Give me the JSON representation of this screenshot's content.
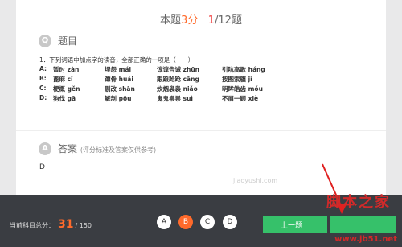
{
  "header": {
    "prefix": "本题",
    "score": "3分",
    "current": "1",
    "total": "/12题"
  },
  "question": {
    "circle": "Q",
    "title": "题目",
    "stem": "1．下列词语中加点字的读音，全部正确的一项是（　　）",
    "options": [
      {
        "letter": "A:",
        "w1": "暂时 zàn",
        "w2": "埋怨 mái",
        "w3": "谆谆告诫 zhūn",
        "w4": "引吭高歌 háng"
      },
      {
        "letter": "B:",
        "w1": "蓖麻 cǐ",
        "w2": "蹿骨 huái",
        "w3": "跟踉跄跄 cāng",
        "w4": "按图索骥 jì"
      },
      {
        "letter": "C:",
        "w1": "梗概 gěn",
        "w2": "剔改 shān",
        "w3": "炊烟袅袅 niǎo",
        "w4": "明眸皓齿 móu"
      },
      {
        "letter": "D:",
        "w1": "狗伐 gā",
        "w2": "解剖 pōu",
        "w3": "鬼鬼祟祟 suì",
        "w4": "不屑一顾 xiè"
      }
    ]
  },
  "answer": {
    "circle": "A",
    "title": "答案",
    "note": "(评分标准及答案仅供参考)",
    "value": "D"
  },
  "footer": {
    "total_label": "当前科目总分：",
    "total_value": "31",
    "total_max": "/ 150",
    "choices": [
      "A",
      "B",
      "C",
      "D"
    ],
    "selected": "B",
    "prev_label": "上一题"
  },
  "watermark": {
    "text": "脚本之家",
    "url": "www.jb51.net",
    "site": "jiaoyushi.com"
  },
  "colors": {
    "accent": "#ff6a2b",
    "green": "#36c16a",
    "bottom_bar": "#3a3d42"
  }
}
